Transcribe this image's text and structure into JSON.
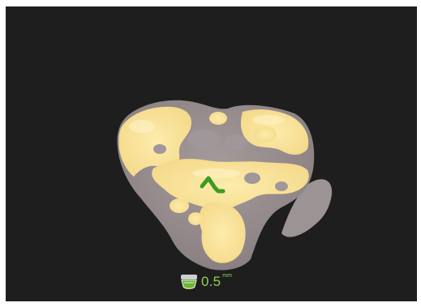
{
  "viewer": {
    "background_color": "#1d1e1d",
    "surface_color": "#9b9192",
    "highlight_color": "#fbe7a1",
    "marker_color": "#3f9b1f",
    "accent_color": "#8fd14f"
  },
  "status": {
    "icon": "depth-layer-icon",
    "value": "0.5",
    "unit": "mm"
  }
}
